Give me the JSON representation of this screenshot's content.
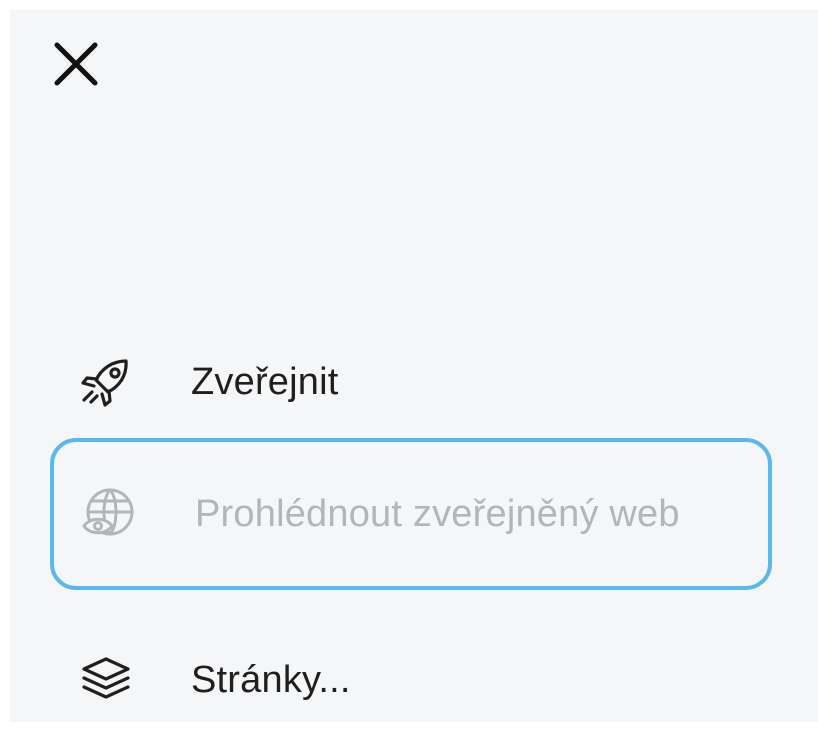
{
  "header": {
    "close_icon": "close-icon"
  },
  "menu": {
    "items": [
      {
        "label": "Zveřejnit",
        "icon": "rocket-icon",
        "disabled": false
      },
      {
        "label": "Prohlédnout zveřejněný web",
        "icon": "globe-eye-icon",
        "disabled": true,
        "focused": true
      },
      {
        "label": "Stránky...",
        "icon": "layers-icon",
        "disabled": false
      }
    ]
  },
  "colors": {
    "panel_background": "#f5f6f8",
    "text": "#1f1f1f",
    "disabled_text": "#b3b5b9",
    "focus_ring": "#5ab8ec"
  }
}
